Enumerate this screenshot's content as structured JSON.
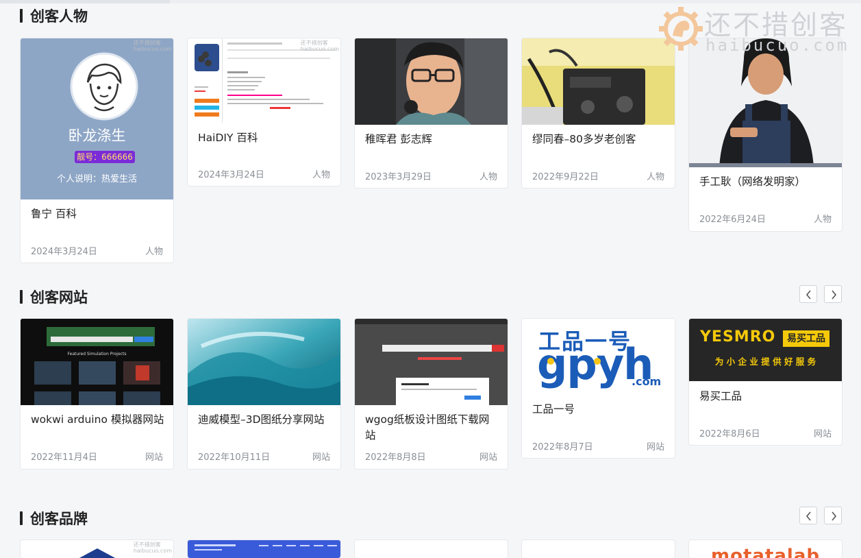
{
  "watermark": {
    "cn": "还不措创客",
    "en": "haibucuo.com",
    "small_cn": "还不措创客",
    "small_en": "haibucuo.com"
  },
  "sections": [
    {
      "title": "创客人物",
      "cards": [
        {
          "title": "鲁宁 百科",
          "date": "2024年3月24日",
          "category": "人物",
          "thumb": {
            "name": "卧龙涤生",
            "badge": "靓号：666666",
            "desc": "个人说明：热爱生活"
          }
        },
        {
          "title": "HaiDIY 百科",
          "date": "2024年3月24日",
          "category": "人物"
        },
        {
          "title": "稚晖君 彭志辉",
          "date": "2023年3月29日",
          "category": "人物"
        },
        {
          "title": "缪同春–80多岁老创客",
          "date": "2022年9月22日",
          "category": "人物"
        },
        {
          "title": "手工耿（网络发明家）",
          "date": "2022年6月24日",
          "category": "人物"
        }
      ]
    },
    {
      "title": "创客网站",
      "cards": [
        {
          "title": "wokwi arduino 模拟器网站",
          "date": "2022年11月4日",
          "category": "网站",
          "thumb": {
            "headline": "Featured Simulation Projects"
          }
        },
        {
          "title": "迪威模型–3D图纸分享网站",
          "date": "2022年10月11日",
          "category": "网站"
        },
        {
          "title": "wgog纸板设计图纸下载网站",
          "date": "2022年8月8日",
          "category": "网站"
        },
        {
          "title": "工品一号",
          "date": "2022年8月7日",
          "category": "网站",
          "thumb": {
            "line1": "工品一号",
            "line2": "gpyh",
            "line3": ".com"
          }
        },
        {
          "title": "易买工品",
          "date": "2022年8月6日",
          "category": "网站",
          "thumb": {
            "brand": "YESMRO",
            "brand_cn": "易买工品",
            "slogan": "为 小 企 业 提 供 好 服 务"
          }
        }
      ]
    },
    {
      "title": "创客品牌",
      "cards": [
        {
          "thumb": {
            "brand": "motatalab"
          }
        }
      ]
    }
  ],
  "colors": {
    "background": "#f5f6f8",
    "card_bg": "#ffffff",
    "meta_text": "#8a8f96",
    "title_text": "#222222"
  }
}
